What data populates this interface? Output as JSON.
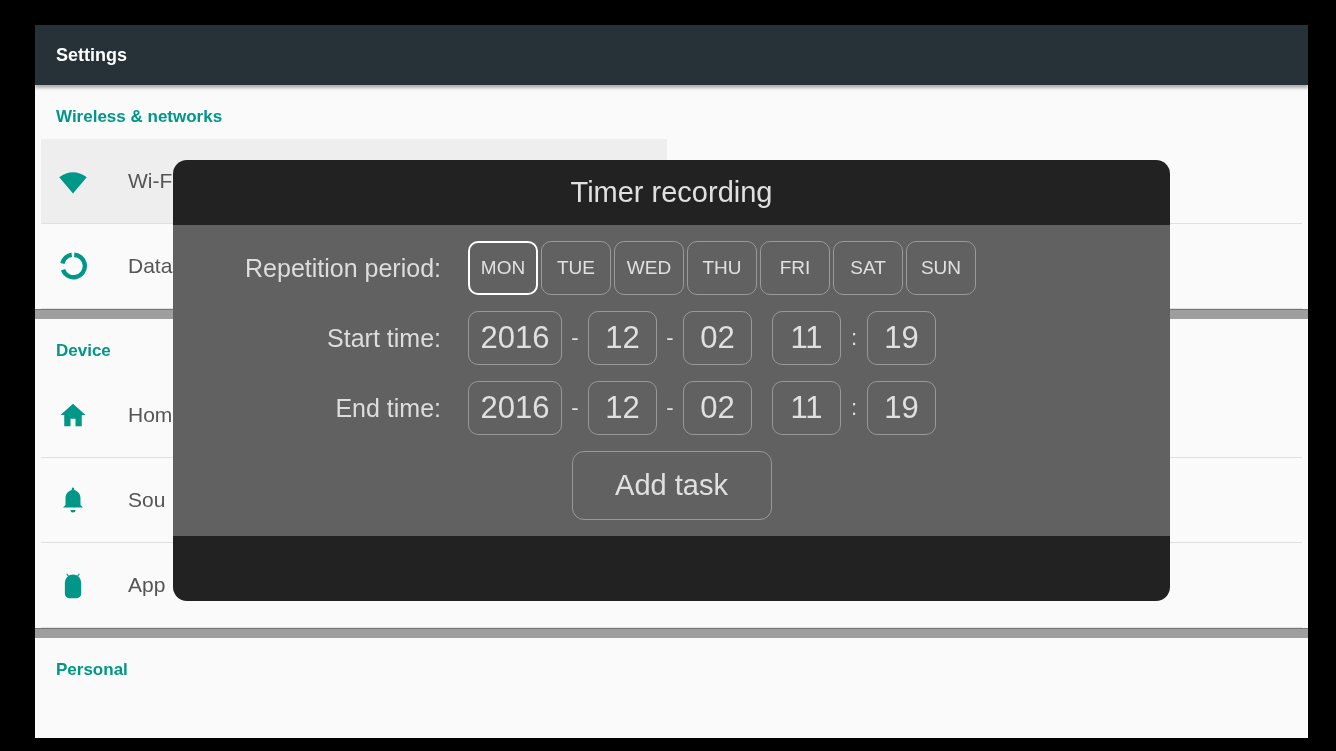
{
  "header": {
    "title": "Settings"
  },
  "sections": [
    {
      "title": "Wireless & networks",
      "items": [
        {
          "label": "Wi-F",
          "kind": "wifi",
          "selected": true
        },
        {
          "label": "Data",
          "kind": "data",
          "selected": false
        }
      ]
    },
    {
      "title": "Device",
      "items": [
        {
          "label": "Hom",
          "kind": "home",
          "selected": false
        },
        {
          "label": "Sou",
          "kind": "sound",
          "selected": false
        },
        {
          "label": "App",
          "kind": "apps",
          "selected": false
        }
      ]
    },
    {
      "title": "Personal"
    }
  ],
  "dialog": {
    "title": "Timer recording",
    "repetition": {
      "label": "Repetition period:",
      "days": [
        {
          "label": "MON",
          "selected": true
        },
        {
          "label": "TUE",
          "selected": false
        },
        {
          "label": "WED",
          "selected": false
        },
        {
          "label": "THU",
          "selected": false
        },
        {
          "label": "FRI",
          "selected": false
        },
        {
          "label": "SAT",
          "selected": false
        },
        {
          "label": "SUN",
          "selected": false
        }
      ]
    },
    "times": [
      {
        "label": "Start time:",
        "parts": [
          {
            "kind": "field",
            "text": "2016"
          },
          {
            "kind": "sep",
            "text": "-"
          },
          {
            "kind": "field",
            "text": "12"
          },
          {
            "kind": "sep",
            "text": "-"
          },
          {
            "kind": "field",
            "text": "02"
          },
          {
            "kind": "field",
            "text": "11"
          },
          {
            "kind": "sep",
            "text": ":"
          },
          {
            "kind": "field",
            "text": "19"
          }
        ]
      },
      {
        "label": "End time:",
        "parts": [
          {
            "kind": "field",
            "text": "2016"
          },
          {
            "kind": "sep",
            "text": "-"
          },
          {
            "kind": "field",
            "text": "12"
          },
          {
            "kind": "sep",
            "text": "-"
          },
          {
            "kind": "field",
            "text": "02"
          },
          {
            "kind": "field",
            "text": "11"
          },
          {
            "kind": "sep",
            "text": ":"
          },
          {
            "kind": "field",
            "text": "19"
          }
        ]
      }
    ],
    "button": "Add task"
  }
}
